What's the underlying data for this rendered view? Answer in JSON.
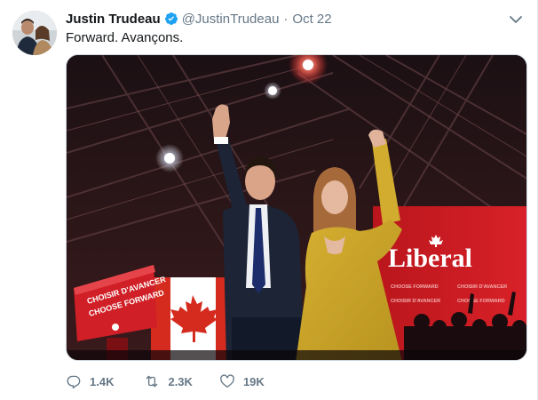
{
  "tweet": {
    "author": {
      "name": "Justin Trudeau",
      "handle": "@JustinTrudeau",
      "verified": true,
      "avatar_icon": "avatar-photo"
    },
    "separator": "·",
    "date": "Oct 22",
    "text": "Forward. Avançons.",
    "actions": {
      "reply_count": "1.4K",
      "retweet_count": "2.3K",
      "like_count": "19K"
    },
    "icons": {
      "verified": "verified-badge-icon",
      "menu": "chevron-down-icon",
      "reply": "reply-icon",
      "retweet": "retweet-icon",
      "like": "heart-icon"
    },
    "colors": {
      "accent": "#1da1f2",
      "muted": "#657786",
      "liberal_red": "#d71920"
    }
  },
  "media": {
    "podium_text_1": "CHOISIR D'AVANCER",
    "podium_text_2": "CHOOSE FORWARD",
    "banner_logo": "Liberal",
    "banner_small_1": "CHOOSE FORWARD",
    "banner_small_2": "CHOISIR D'AVANCER"
  }
}
